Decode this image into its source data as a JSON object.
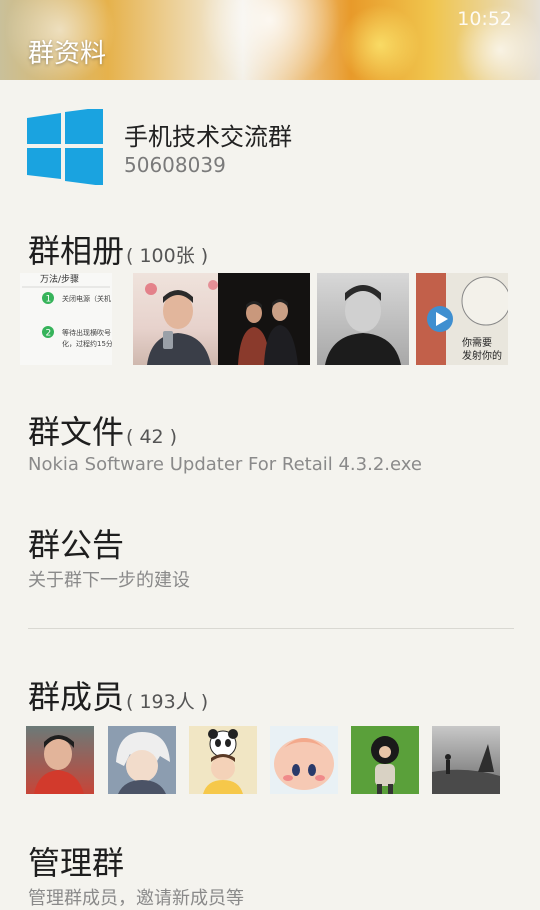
{
  "status_bar": {
    "time": "10:52"
  },
  "header": {
    "title": "群资料"
  },
  "group": {
    "name": "手机技术交流群",
    "id": "50608039"
  },
  "album": {
    "title": "群相册",
    "count": "( 100张 )",
    "photos": [
      {
        "lines": [
          "万法/步骤",
          "关闭电源（关机",
          "等待出现横吹号",
          "化，过程约15分"
        ],
        "badges": [
          "1",
          "2"
        ]
      },
      {},
      {},
      {},
      {
        "lines": [
          "你需要",
          "发射你的"
        ]
      }
    ]
  },
  "files": {
    "title": "群文件",
    "count": "( 42 )",
    "latest": "Nokia Software Updater For Retail 4.3.2.exe"
  },
  "announcement": {
    "title": "群公告",
    "latest": "关于群下一步的建设"
  },
  "members": {
    "title": "群成员",
    "count": "( 193人 )"
  },
  "manage": {
    "title": "管理群",
    "subtitle": "管理群成员，邀请新成员等"
  },
  "colors": {
    "accent_blue": "#1aa3e0",
    "background": "#f4f3ee"
  }
}
